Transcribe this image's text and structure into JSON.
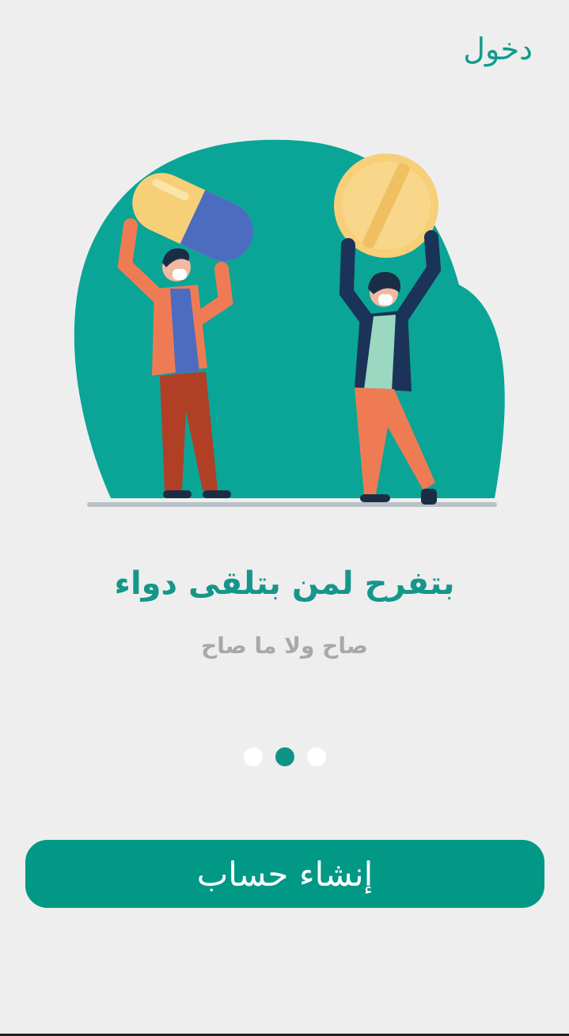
{
  "header": {
    "login_label": "دخول"
  },
  "onboarding": {
    "title": "بتفرح لمن بتلقى دواء",
    "subtitle": "صاح ولا ما صاح",
    "page_indicator": {
      "total": 3,
      "active_index": 1
    }
  },
  "actions": {
    "create_account_label": "إنشاء حساب"
  },
  "colors": {
    "accent": "#019886",
    "title": "#16968a",
    "subtitle": "#a8a8a8",
    "background": "#eeeeee",
    "blob": "#0aa597"
  }
}
